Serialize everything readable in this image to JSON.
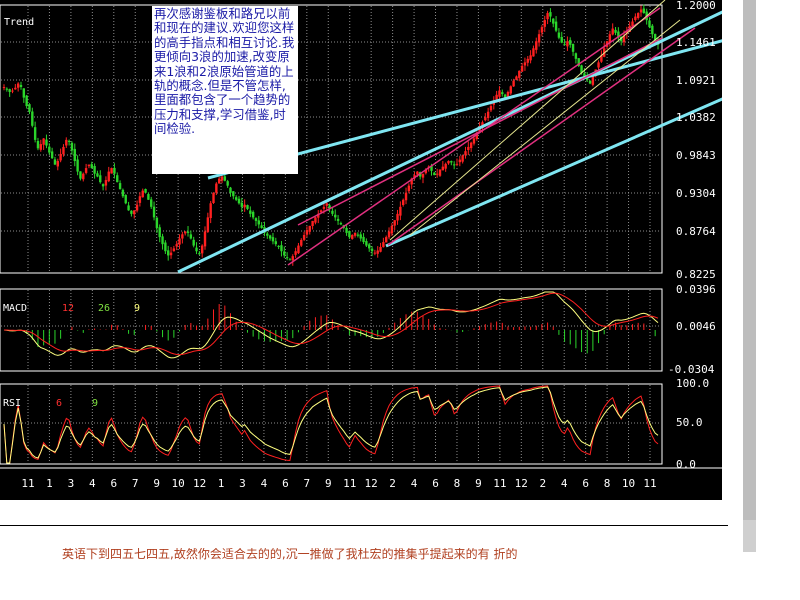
{
  "annotation": {
    "text": "再次感谢鉴板和路兄以前和现在的建议.欢迎您这样的高手指点和相互讨论.我更倾向3浪的加速,改变原来1浪和2浪原始管道的上轨的概念.但是不管怎样,里面都包含了一个趋势的压力和支撑,学习借鉴,时间检验."
  },
  "footer": {
    "text": "英语下到四五七四五,故然你会适合去的的,沉一推做了我杜宏的推集乎提起来的有 折的"
  },
  "colors": {
    "background": "#000000",
    "grid": "#8c8c8c",
    "up_candle": "#ff2020",
    "down_candle": "#2bd52b",
    "channel_main": "#7fe6f2",
    "channel_inner": "#e0307f",
    "channel_thin": "#e8e890",
    "axis_text": "#ffffff",
    "label_red": "#ff3030",
    "label_green": "#7fe040",
    "label_yellow": "#ffff80"
  },
  "chart_data": [
    {
      "type": "candlestick",
      "title": "Trend",
      "y_ticks": [
        "1.2000",
        "1.1461",
        "1.0921",
        "1.0382",
        "0.9843",
        "0.9304",
        "0.8764",
        "0.8225"
      ],
      "ylim": [
        0.8225,
        1.2
      ],
      "x_ticks": [
        "11",
        "1",
        "3",
        "4",
        "6",
        "7",
        "9",
        "10",
        "12",
        "1",
        "3",
        "4",
        "6",
        "7",
        "9",
        "11",
        "12",
        "2",
        "4",
        "6",
        "8",
        "9",
        "11",
        "12",
        "2",
        "4",
        "6",
        "8",
        "10",
        "11"
      ],
      "series": {
        "close": [
          1.085,
          1.082,
          1.078,
          1.08,
          1.084,
          1.09,
          1.085,
          1.07,
          1.058,
          1.05,
          1.03,
          1.01,
          0.998,
          1.004,
          1.012,
          1.002,
          0.992,
          0.984,
          0.975,
          0.98,
          0.99,
          1.0,
          1.01,
          1.008,
          0.995,
          0.98,
          0.965,
          0.955,
          0.962,
          0.97,
          0.975,
          0.97,
          0.962,
          0.958,
          0.95,
          0.944,
          0.953,
          0.965,
          0.97,
          0.962,
          0.95,
          0.94,
          0.93,
          0.92,
          0.91,
          0.905,
          0.91,
          0.918,
          0.93,
          0.938,
          0.935,
          0.925,
          0.915,
          0.9,
          0.885,
          0.872,
          0.862,
          0.852,
          0.846,
          0.85,
          0.856,
          0.862,
          0.87,
          0.876,
          0.88,
          0.878,
          0.87,
          0.86,
          0.852,
          0.848,
          0.86,
          0.88,
          0.9,
          0.92,
          0.935,
          0.948,
          0.955,
          0.958,
          0.952,
          0.945,
          0.935,
          0.93,
          0.925,
          0.92,
          0.915,
          0.918,
          0.912,
          0.905,
          0.9,
          0.895,
          0.89,
          0.885,
          0.878,
          0.874,
          0.87,
          0.866,
          0.862,
          0.858,
          0.852,
          0.846,
          0.842,
          0.84,
          0.845,
          0.852,
          0.86,
          0.868,
          0.875,
          0.882,
          0.888,
          0.895,
          0.9,
          0.905,
          0.91,
          0.915,
          0.92,
          0.912,
          0.905,
          0.9,
          0.895,
          0.89,
          0.885,
          0.878,
          0.872,
          0.875,
          0.878,
          0.874,
          0.87,
          0.865,
          0.86,
          0.856,
          0.852,
          0.85,
          0.853,
          0.858,
          0.865,
          0.872,
          0.88,
          0.888,
          0.896,
          0.905,
          0.915,
          0.925,
          0.935,
          0.945,
          0.955,
          0.96,
          0.965,
          0.958,
          0.962,
          0.968,
          0.972,
          0.966,
          0.96,
          0.962,
          0.968,
          0.972,
          0.976,
          0.98,
          0.978,
          0.974,
          0.976,
          0.982,
          0.988,
          0.994,
          1.0,
          1.006,
          1.012,
          1.02,
          1.028,
          1.035,
          1.042,
          1.05,
          1.058,
          1.066,
          1.074,
          1.08,
          1.075,
          1.07,
          1.078,
          1.086,
          1.094,
          1.1,
          1.108,
          1.115,
          1.12,
          1.125,
          1.13,
          1.14,
          1.15,
          1.16,
          1.17,
          1.18,
          1.19,
          1.185,
          1.175,
          1.165,
          1.155,
          1.148,
          1.145,
          1.15,
          1.145,
          1.135,
          1.125,
          1.115,
          1.105,
          1.1,
          1.095,
          1.09,
          1.1,
          1.11,
          1.12,
          1.13,
          1.14,
          1.15,
          1.16,
          1.168,
          1.162,
          1.155,
          1.15,
          1.158,
          1.165,
          1.172,
          1.178,
          1.185,
          1.19,
          1.195,
          1.19,
          1.18,
          1.17,
          1.16,
          1.15,
          1.145
        ]
      }
    },
    {
      "type": "line",
      "title": "MACD",
      "params": [
        "12",
        "26",
        "9"
      ],
      "y_ticks": [
        "0.0396",
        "0.0046",
        "-0.0304"
      ],
      "ylim": [
        -0.0304,
        0.0396
      ]
    },
    {
      "type": "line",
      "title": "RSI",
      "params": [
        "6",
        "9"
      ],
      "y_ticks": [
        "100.0",
        "50.0",
        "0.0"
      ],
      "ylim": [
        0,
        100
      ]
    }
  ]
}
